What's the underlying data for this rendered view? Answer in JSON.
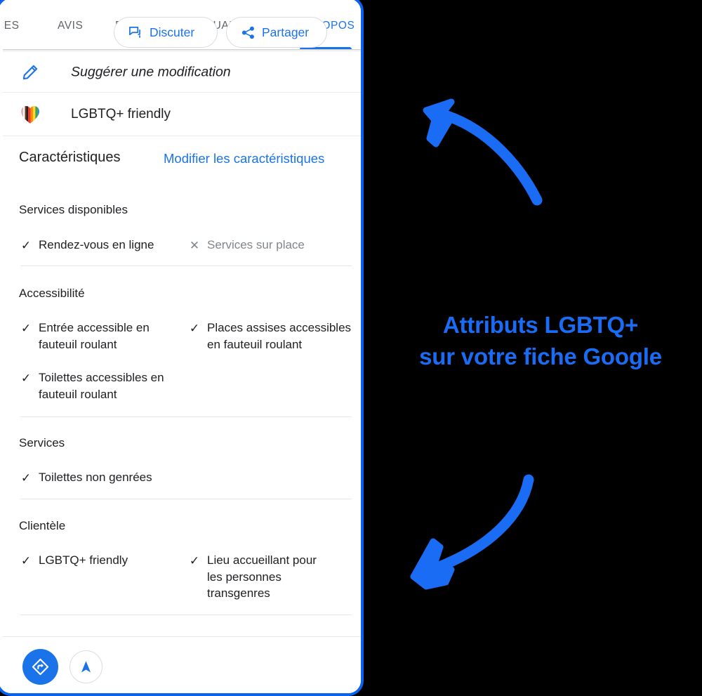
{
  "colors": {
    "accent_blue": "#1a73e8",
    "annotation_blue": "#1a6cf5",
    "border_blue": "#0b62f0",
    "text_primary": "#202124",
    "text_muted": "#80868b",
    "background": "#000000",
    "card_background": "#ffffff"
  },
  "tabs": [
    {
      "label": "CES",
      "active": false
    },
    {
      "label": "AVIS",
      "active": false
    },
    {
      "label": "PHOTOS",
      "active": false
    },
    {
      "label": "ACTUALITÉS",
      "active": false
    },
    {
      "label": "À PROPOS",
      "active": true
    }
  ],
  "rows": [
    {
      "icon": "pencil-icon",
      "label": "Suggérer une modification"
    },
    {
      "icon": "rainbow-heart-icon",
      "label": "LGBTQ+ friendly"
    }
  ],
  "characteristics": {
    "title": "Caractéristiques",
    "edit_link": "Modifier les caractéristiques",
    "sections": [
      {
        "title": "Services disponibles",
        "items": [
          {
            "text": "Rendez-vous en ligne",
            "state": "available",
            "glyph": "✓"
          },
          {
            "text": "Services sur place",
            "state": "unavailable",
            "glyph": "✕"
          }
        ]
      },
      {
        "title": "Accessibilité",
        "items": [
          {
            "text": "Entrée accessible en fauteuil roulant",
            "state": "available",
            "glyph": "✓"
          },
          {
            "text": "Places assises accessibles en fauteuil roulant",
            "state": "available",
            "glyph": "✓"
          },
          {
            "text": "Toilettes accessibles en fauteuil roulant",
            "state": "available",
            "glyph": "✓"
          }
        ]
      },
      {
        "title": "Services",
        "items": [
          {
            "text": "Toilettes non genrées",
            "state": "available",
            "glyph": "✓"
          }
        ]
      },
      {
        "title": "Clientèle",
        "items": [
          {
            "text": "LGBTQ+ friendly",
            "state": "available",
            "glyph": "✓"
          },
          {
            "text": "Lieu accueillant pour les personnes transgenres",
            "state": "available",
            "glyph": "✓"
          }
        ]
      }
    ]
  },
  "bottom_bar": {
    "buttons": [
      {
        "name": "directions-button",
        "icon": "directions-icon",
        "label": ""
      },
      {
        "name": "navigate-button",
        "icon": "navigation-arrow-icon",
        "label": ""
      },
      {
        "name": "chat-button",
        "icon": "chat-bubble-icon",
        "label": "Discuter"
      },
      {
        "name": "share-button",
        "icon": "share-icon",
        "label": "Partager"
      }
    ]
  },
  "annotation": {
    "line1": "Attributs LGBTQ+",
    "line2": "sur votre fiche Google"
  }
}
